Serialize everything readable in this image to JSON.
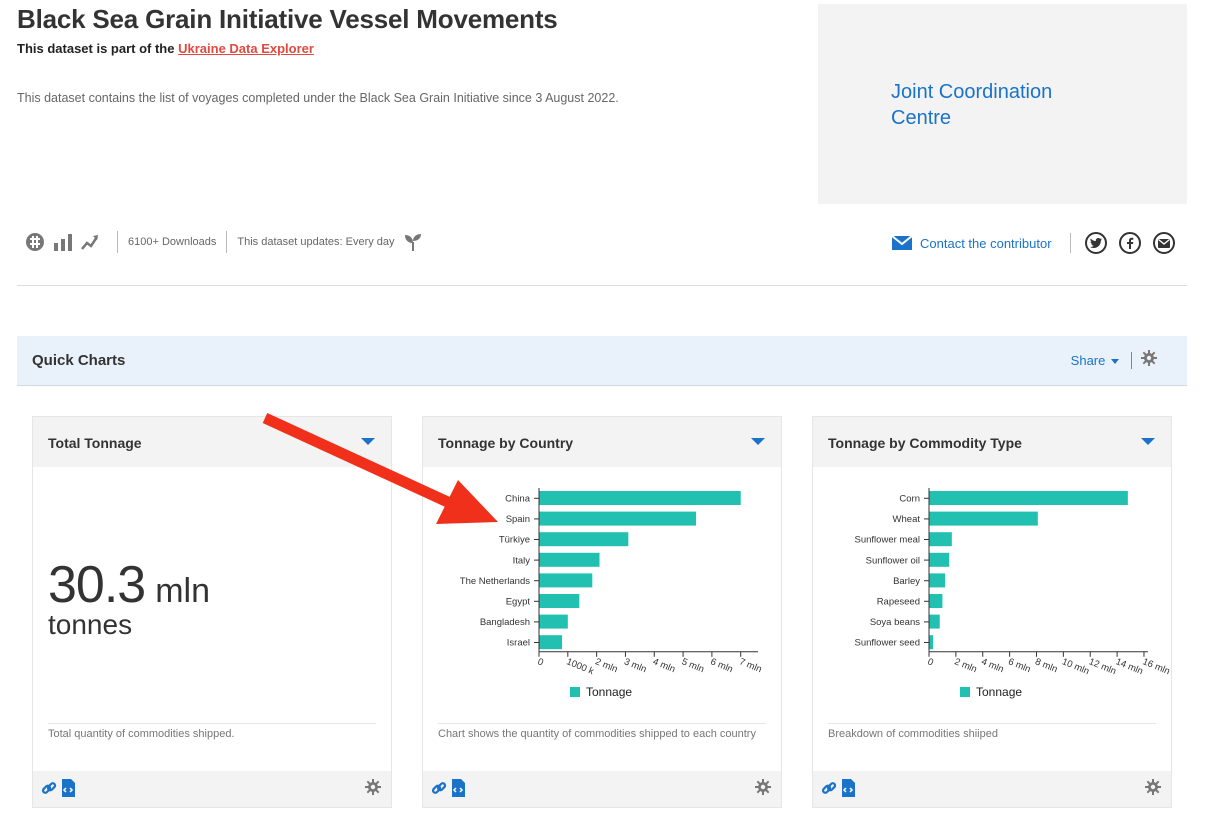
{
  "header": {
    "title": "Black Sea Grain Initiative Vessel Movements",
    "subline_prefix": "This dataset is part of the",
    "subline_link": "Ukraine Data Explorer",
    "description": "This dataset contains the list of voyages completed under the Black Sea Grain Initiative since 3 August 2022."
  },
  "organization": {
    "name": "Joint Coordination Centre"
  },
  "meta": {
    "downloads": "6100+ Downloads",
    "updates": "This dataset updates: Every day"
  },
  "contact": {
    "label": "Contact the contributor"
  },
  "quick_charts": {
    "title": "Quick Charts",
    "share_label": "Share"
  },
  "colors": {
    "accent": "#1a73c8",
    "bar": "#22c0b0",
    "link": "#e04a3f"
  },
  "cards": [
    {
      "title": "Total Tonnage",
      "value": "30.3",
      "unit": "mln",
      "sub": "tonnes",
      "description": "Total quantity of commodities shipped."
    },
    {
      "title": "Tonnage by Country",
      "description": "Chart shows the quantity of commodities shipped to each country",
      "legend": "Tonnage"
    },
    {
      "title": "Tonnage by Commodity Type",
      "description": "Breakdown of commodities shiiped",
      "legend": "Tonnage"
    }
  ],
  "chart_data": [
    {
      "type": "bar",
      "orientation": "horizontal",
      "categories": [
        "China",
        "Spain",
        "Türkiye",
        "Italy",
        "The Netherlands",
        "Egypt",
        "Bangladesh",
        "Israel"
      ],
      "values": [
        7000000,
        5450000,
        3100000,
        2100000,
        1850000,
        1400000,
        1000000,
        800000
      ],
      "series": [
        {
          "name": "Tonnage",
          "values": [
            7000000,
            5450000,
            3100000,
            2100000,
            1850000,
            1400000,
            1000000,
            800000
          ]
        }
      ],
      "x_ticks": [
        0,
        1000000,
        2000000,
        3000000,
        4000000,
        5000000,
        6000000,
        7000000
      ],
      "x_tick_labels": [
        "0",
        "1000 k",
        "2 mln",
        "3 mln",
        "4 mln",
        "5 mln",
        "6 mln",
        "7 mln"
      ],
      "xlim": [
        0,
        7600000
      ],
      "legend": "bottom"
    },
    {
      "type": "bar",
      "orientation": "horizontal",
      "categories": [
        "Corn",
        "Wheat",
        "Sunflower meal",
        "Sunflower oil",
        "Barley",
        "Rapeseed",
        "Soya beans",
        "Sunflower seed"
      ],
      "values": [
        14800000,
        8100000,
        1700000,
        1500000,
        1200000,
        1000000,
        800000,
        300000
      ],
      "series": [
        {
          "name": "Tonnage",
          "values": [
            14800000,
            8100000,
            1700000,
            1500000,
            1200000,
            1000000,
            800000,
            300000
          ]
        }
      ],
      "x_ticks": [
        0,
        2000000,
        4000000,
        6000000,
        8000000,
        10000000,
        12000000,
        14000000,
        16000000
      ],
      "x_tick_labels": [
        "0",
        "2 mln",
        "4 mln",
        "6 mln",
        "8 mln",
        "10 mln",
        "12 mln",
        "14 mln",
        "16 mln"
      ],
      "xlim": [
        0,
        16300000
      ],
      "legend": "bottom"
    }
  ]
}
